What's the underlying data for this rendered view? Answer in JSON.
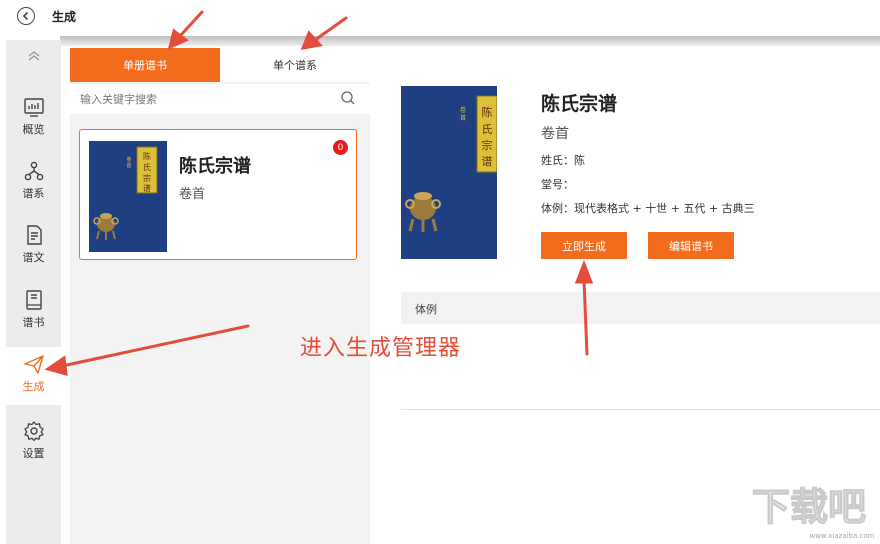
{
  "header": {
    "title": "生成"
  },
  "nav": {
    "items": [
      {
        "label": "概览"
      },
      {
        "label": "谱系"
      },
      {
        "label": "谱文"
      },
      {
        "label": "谱书"
      },
      {
        "label": "生成"
      },
      {
        "label": "设置"
      }
    ]
  },
  "tabs": [
    {
      "label": "单册谱书"
    },
    {
      "label": "单个谱系"
    }
  ],
  "search": {
    "placeholder": "输入关键字搜索"
  },
  "book_card": {
    "title": "陈氏宗谱",
    "subtitle": "卷首",
    "badge": "0",
    "cover_spine_text": "陈氏宗谱",
    "cover_side_text": "卷首"
  },
  "detail": {
    "title": "陈氏宗谱",
    "subtitle": "卷首",
    "surname": "姓氏：陈",
    "hall": "堂号：",
    "style": "体例：现代表格式 + 十世 + 五代 + 古典三",
    "btn_generate": "立即生成",
    "btn_edit": "编辑谱书",
    "section_label": "体例"
  },
  "annotation": {
    "text": "进入生成管理器"
  },
  "watermark": {
    "text": "下载吧",
    "url": "www.xiazaiba.com"
  },
  "colors": {
    "accent": "#f36c1d",
    "arrow": "#e44d3a",
    "cover_blue": "#1e3f82"
  }
}
